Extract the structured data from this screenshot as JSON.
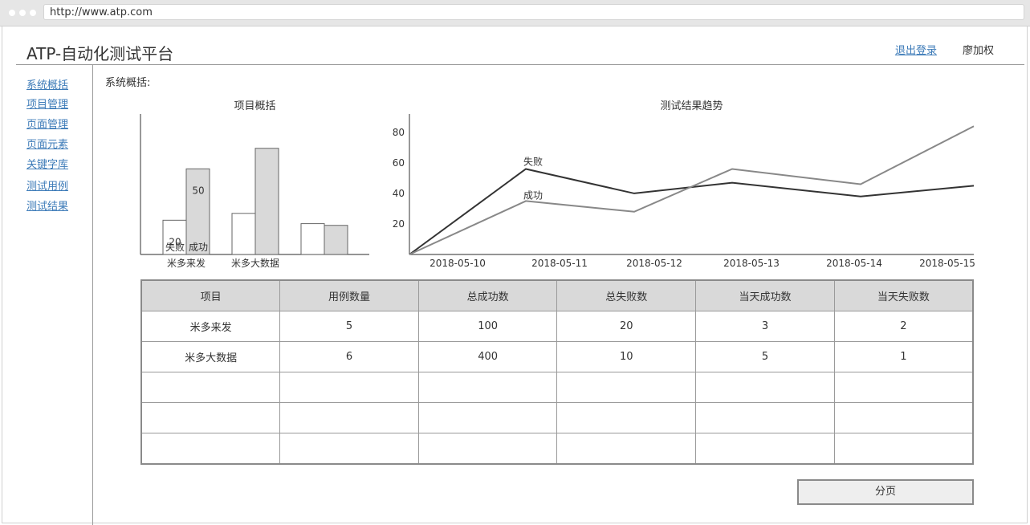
{
  "browser": {
    "url": "http://www.atp.com"
  },
  "header": {
    "title": "ATP-自动化测试平台",
    "logout_label": "退出登录",
    "user_name": "廖加权"
  },
  "sidebar": {
    "items": [
      {
        "label": "系统概括"
      },
      {
        "label": "项目管理"
      },
      {
        "label": "页面管理"
      },
      {
        "label": "页面元素"
      },
      {
        "label": "关键字库"
      },
      {
        "label": "测试用例"
      },
      {
        "label": "测试结果"
      }
    ]
  },
  "main": {
    "section_label": "系统概括:"
  },
  "colors": {
    "link": "#3d7bb8",
    "success_fill": "#d9d9d9",
    "fail_line": "#333333",
    "success_line": "#888888"
  },
  "chart_data": [
    {
      "type": "bar",
      "title": "项目概括",
      "categories": [
        "米多来发",
        "米多大数据",
        ""
      ],
      "series": [
        {
          "name": "失败",
          "values": [
            20,
            24,
            18
          ]
        },
        {
          "name": "成功",
          "values": [
            50,
            62,
            17
          ]
        }
      ],
      "data_labels": [
        "20",
        "50"
      ],
      "ylim": [
        0,
        75
      ]
    },
    {
      "type": "line",
      "title": "测试结果趋势",
      "x": [
        "2018-05-10",
        "2018-05-11",
        "2018-05-12",
        "2018-05-13",
        "2018-05-14",
        "2018-05-15"
      ],
      "yticks": [
        20,
        40,
        60,
        80
      ],
      "ylim": [
        0,
        92
      ],
      "series": [
        {
          "name": "失败",
          "values": [
            0,
            56,
            40,
            47,
            38,
            45
          ]
        },
        {
          "name": "成功",
          "values": [
            0,
            35,
            28,
            56,
            46,
            84
          ]
        }
      ]
    }
  ],
  "table": {
    "headers": [
      "项目",
      "用例数量",
      "总成功数",
      "总失败数",
      "当天成功数",
      "当天失败数"
    ],
    "rows": [
      [
        "米多来发",
        "5",
        "100",
        "20",
        "3",
        "2"
      ],
      [
        "米多大数据",
        "6",
        "400",
        "10",
        "5",
        "1"
      ],
      [
        "",
        "",
        "",
        "",
        "",
        ""
      ],
      [
        "",
        "",
        "",
        "",
        "",
        ""
      ],
      [
        "",
        "",
        "",
        "",
        "",
        ""
      ]
    ]
  },
  "pager": {
    "label": "分页"
  }
}
